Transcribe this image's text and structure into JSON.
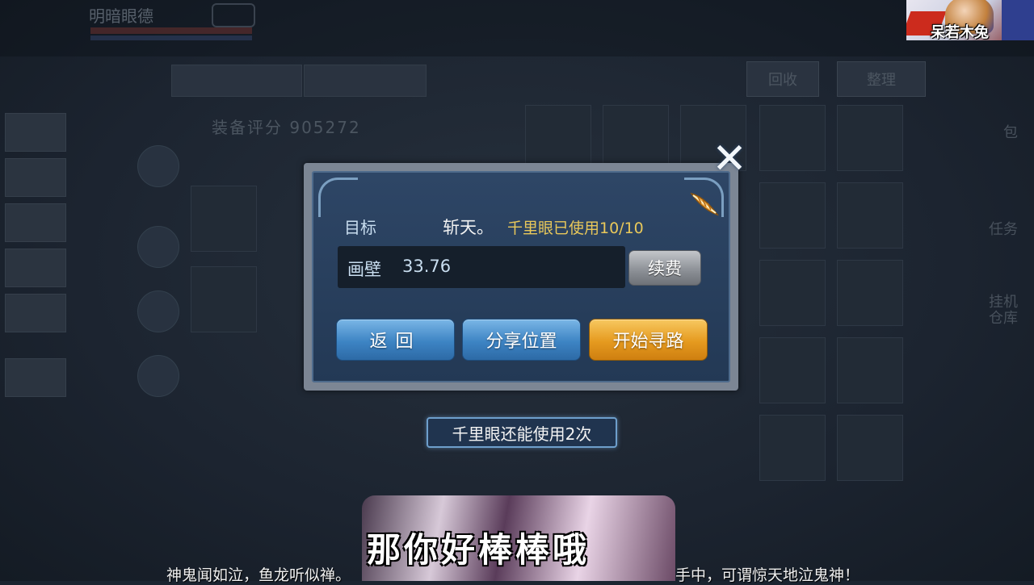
{
  "background": {
    "player_name": "明暗眼德",
    "equip_score": "装备评分 905272",
    "recycle_label": "回收",
    "sort_label": "整理",
    "right_labels": [
      "包",
      "任务",
      "挂机",
      "仓库"
    ]
  },
  "streamer": {
    "name": "呆若木兔"
  },
  "dialog": {
    "target_label": "目标",
    "target_name": "斩天。",
    "usage_text": "千里眼已使用10/10",
    "location_name": "画壁",
    "location_coord": "33.76",
    "renew_label": "续费",
    "back_label": "返回",
    "share_label": "分享位置",
    "start_label": "开始寻路",
    "close_icon": "close-icon",
    "feather_icon": "feather-icon"
  },
  "remaining": {
    "text": "千里眼还能使用2次"
  },
  "sticker": {
    "text": "那你好棒棒哦"
  },
  "subtitle": {
    "left": "神鬼闻如泣，鱼龙听似禅。",
    "right": "手中，可谓惊天地泣鬼神！"
  },
  "colors": {
    "accent_gold": "#e9c85a",
    "button_blue": "#3d84c4",
    "button_orange": "#e59a1f",
    "panel_bg": "#2e4666"
  }
}
